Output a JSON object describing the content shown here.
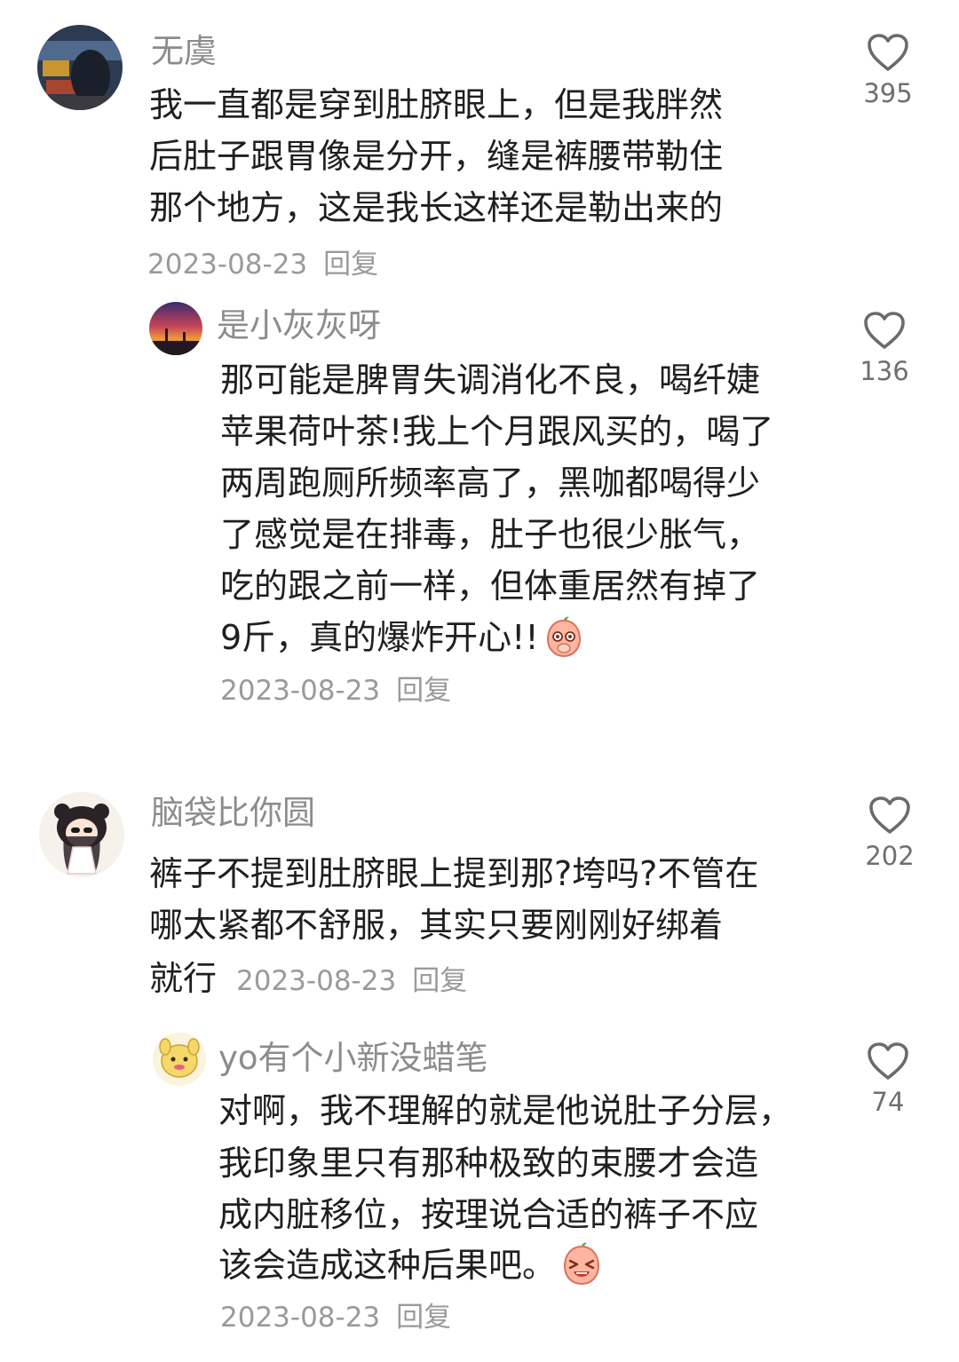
{
  "comments": [
    {
      "username": "无虞",
      "lines": [
        "我一直都是穿到肚脐眼上，但是我胖然",
        "后肚子跟胃像是分开，缝是裤腰带勒住",
        "那个地方，这是我长这样还是勒出来的"
      ],
      "date": "2023-08-23",
      "reply": "回复",
      "likes": "395"
    },
    {
      "username": "是小灰灰呀",
      "lines": [
        "那可能是脾胃失调消化不良，喝纤婕",
        "苹果荷叶茶!我上个月跟风买的，喝了",
        "两周跑厕所频率高了，黑咖都喝得少",
        "了感觉是在排毒，肚子也很少胀气，",
        "吃的跟之前一样，但体重居然有掉了",
        "9斤，真的爆炸开心!!"
      ],
      "date": "2023-08-23",
      "reply": "回复",
      "likes": "136"
    },
    {
      "username": "脑袋比你圆",
      "lines": [
        "裤子不提到肚脐眼上提到那?垮吗?不管在",
        "哪太紧都不舒服，其实只要刚刚好绑着",
        "就行"
      ],
      "date": "2023-08-23",
      "reply": "回复",
      "likes": "202"
    },
    {
      "username": "yo有个小新没蜡笔",
      "lines": [
        "对啊，我不理解的就是他说肚子分层，",
        "我印象里只有那种极致的束腰才会造",
        "成内脏移位，按理说合适的裤子不应",
        "该会造成这种后果吧。"
      ],
      "date": "2023-08-23",
      "reply": "回复",
      "likes": "74"
    }
  ],
  "icons": {
    "like": "heart-outline-icon",
    "emoji_1": "peach-face-emoji",
    "emoji_2": "peach-crying-emoji"
  },
  "colors": {
    "username": "#8c8c8c",
    "text": "#1f1f1f",
    "meta": "#9a9a9a"
  }
}
